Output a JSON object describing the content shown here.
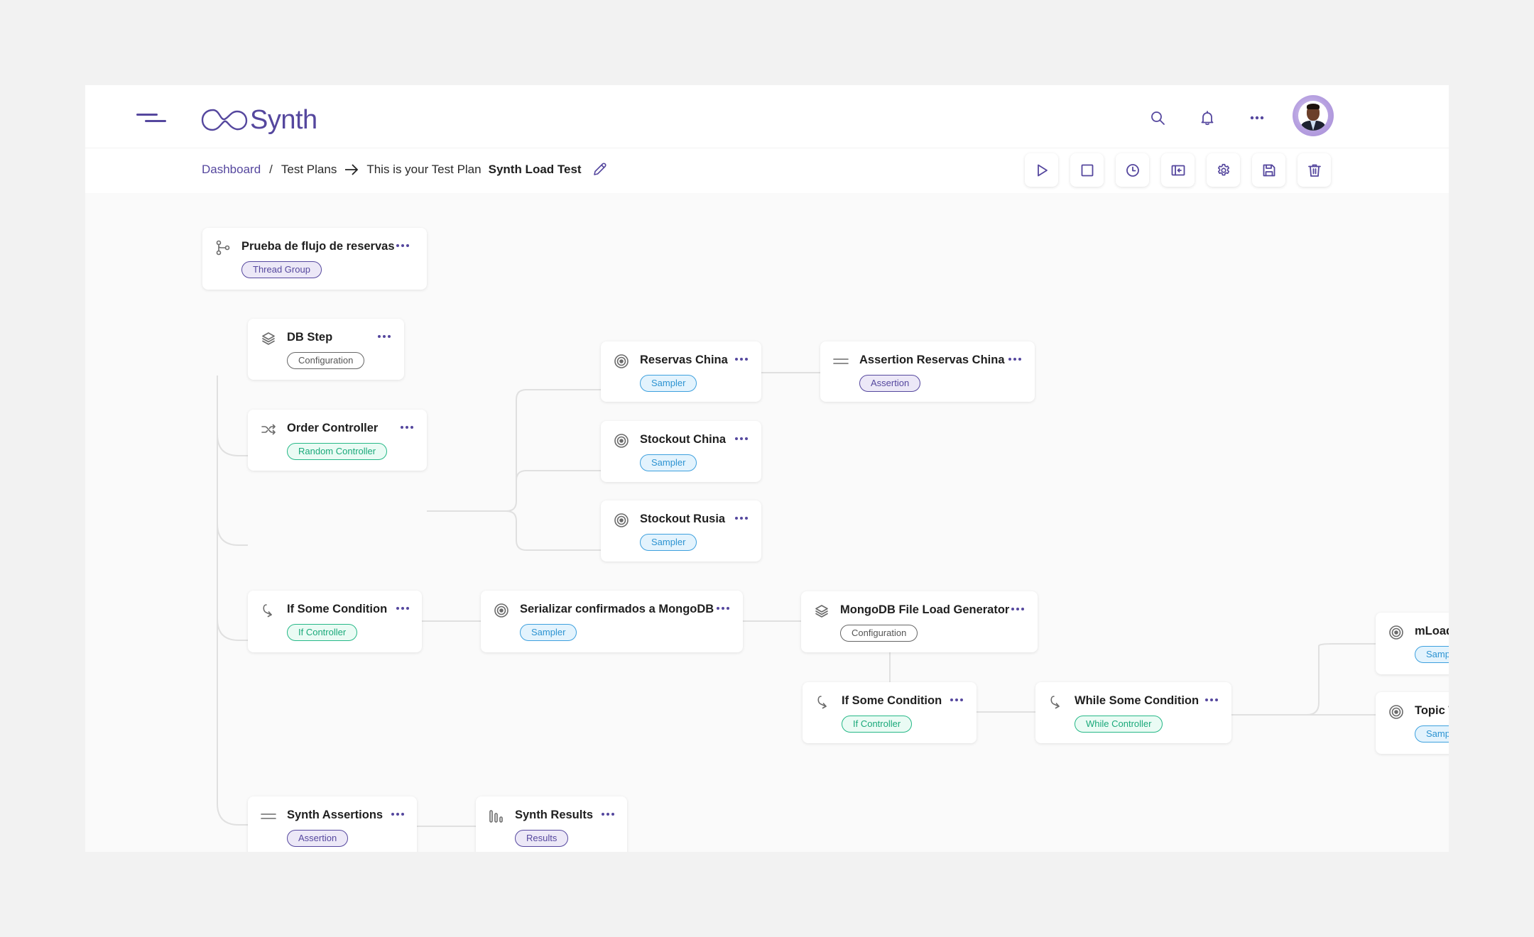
{
  "app": {
    "brand": "Synth",
    "accent_color": "#55479e"
  },
  "header": {
    "menu_icon": "menu-icon",
    "actions": [
      {
        "name": "search",
        "icon": "search-icon"
      },
      {
        "name": "notifications",
        "icon": "bell-icon"
      },
      {
        "name": "more",
        "icon": "more-horizontal-icon"
      }
    ],
    "avatar_alt": "User avatar"
  },
  "breadcrumb": {
    "dashboard": "Dashboard",
    "separator": "/",
    "test_plans": "Test Plans",
    "prefix": "This is your Test Plan",
    "plan_name": "Synth Load Test"
  },
  "toolbar": [
    {
      "name": "run",
      "icon": "play-icon"
    },
    {
      "name": "stop",
      "icon": "stop-icon"
    },
    {
      "name": "history",
      "icon": "clock-icon"
    },
    {
      "name": "collapse-panel",
      "icon": "panel-collapse-icon"
    },
    {
      "name": "settings",
      "icon": "gear-icon"
    },
    {
      "name": "save",
      "icon": "save-icon"
    },
    {
      "name": "delete",
      "icon": "trash-icon"
    }
  ],
  "nodes": [
    {
      "id": "prueba",
      "title": "Prueba de flujo de reservas",
      "tag": "Thread Group",
      "icon": "branch-icon"
    },
    {
      "id": "dbstep",
      "title": "DB Step",
      "tag": "Configuration",
      "icon": "layers-icon"
    },
    {
      "id": "order",
      "title": "Order Controller",
      "tag": "Random Controller",
      "icon": "shuffle-icon"
    },
    {
      "id": "if1",
      "title": "If Some Condition",
      "tag": "If Controller",
      "icon": "curve-arrow-icon"
    },
    {
      "id": "assertions",
      "title": "Synth Assertions",
      "tag": "Assertion",
      "icon": "equals-icon"
    },
    {
      "id": "results",
      "title": "Synth Results",
      "tag": "Results",
      "icon": "bars-icon"
    },
    {
      "id": "serializar",
      "title": "Serializar confirmados a MongoDB",
      "tag": "Sampler",
      "icon": "target-icon"
    },
    {
      "id": "reservas",
      "title": "Reservas China",
      "tag": "Sampler",
      "icon": "target-icon"
    },
    {
      "id": "stockchina",
      "title": "Stockout China",
      "tag": "Sampler",
      "icon": "target-icon"
    },
    {
      "id": "stockrusia",
      "title": "Stockout Rusia",
      "tag": "Sampler",
      "icon": "target-icon"
    },
    {
      "id": "assertres",
      "title": "Assertion Reservas China",
      "tag": "Assertion",
      "icon": "equals-icon"
    },
    {
      "id": "mongo",
      "title": "MongoDB File Load Generator",
      "tag": "Configuration",
      "icon": "layers-icon"
    },
    {
      "id": "if2",
      "title": "If Some Condition",
      "tag": "If Controller",
      "icon": "curve-arrow-icon"
    },
    {
      "id": "while",
      "title": "While Some Condition",
      "tag": "While Controller",
      "icon": "curve-arrow-icon"
    },
    {
      "id": "mload",
      "title": "mLoad",
      "tag": "Sampler",
      "icon": "target-icon"
    },
    {
      "id": "topic",
      "title": "Topic T",
      "tag": "Sampler",
      "icon": "target-icon"
    }
  ],
  "zoom_controls": [
    {
      "name": "zoom-in",
      "icon": "zoom-in-icon"
    },
    {
      "name": "zoom-out",
      "icon": "zoom-out-icon"
    },
    {
      "name": "fit-screen",
      "icon": "expand-icon"
    },
    {
      "name": "exit-fit",
      "icon": "collapse-icon"
    }
  ]
}
